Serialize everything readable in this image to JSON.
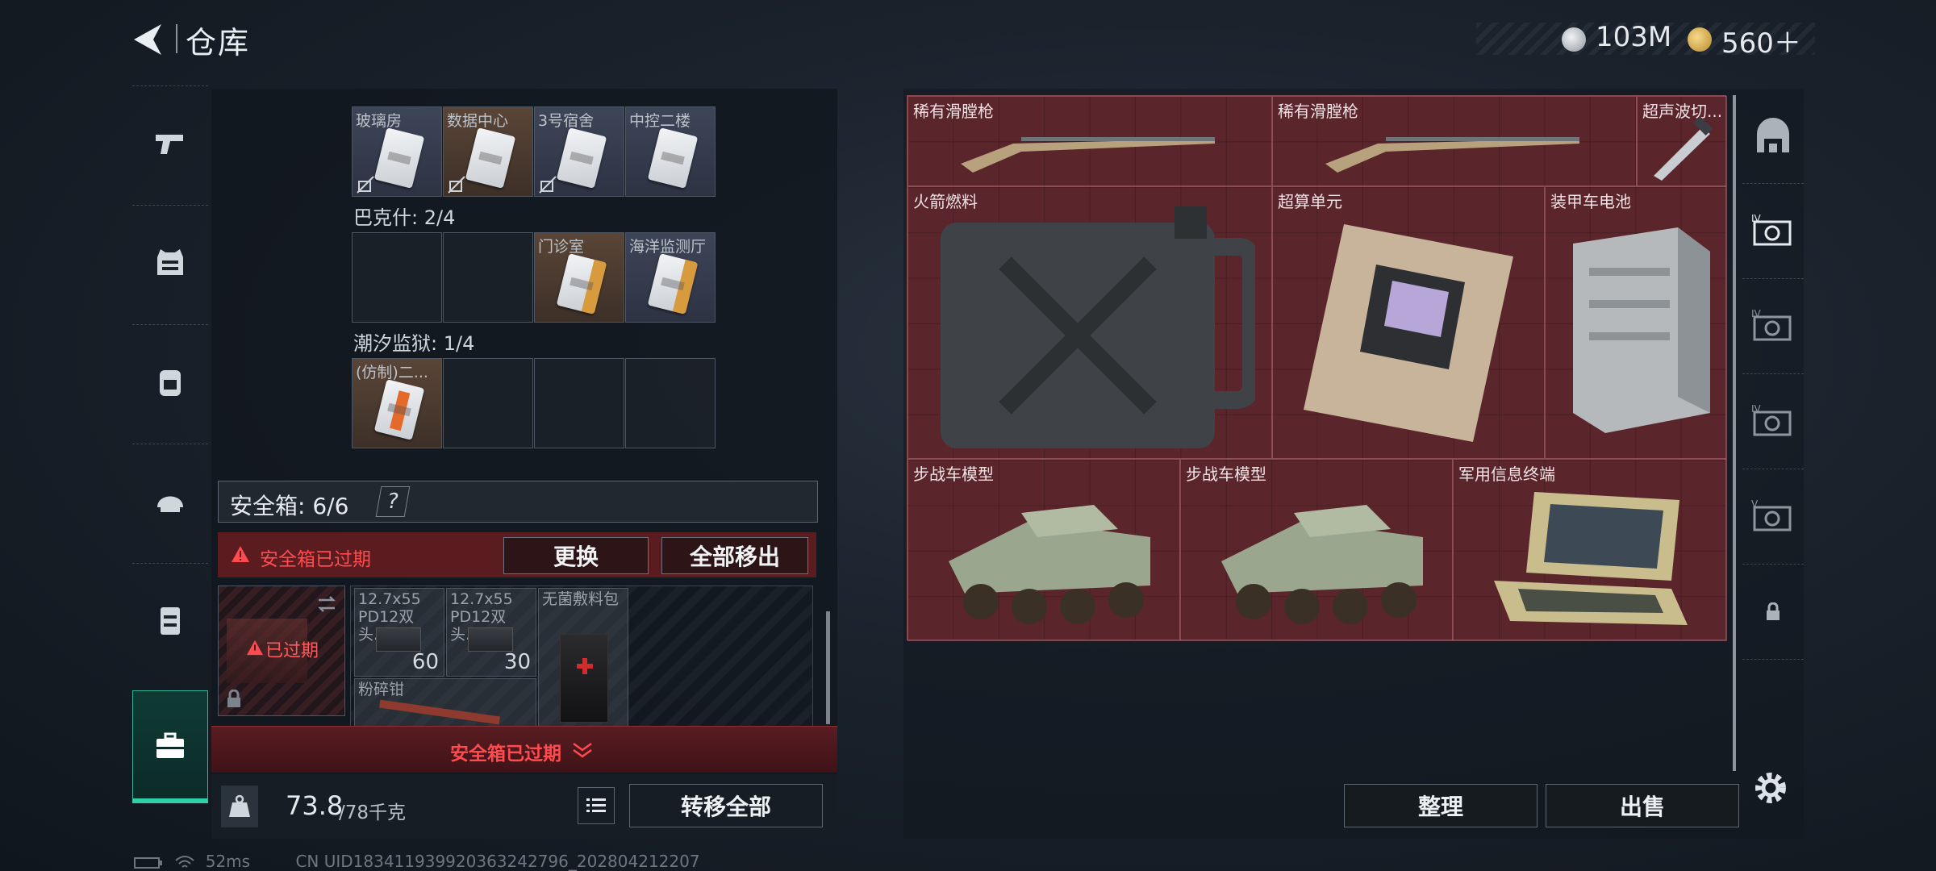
{
  "header": {
    "title": "仓库"
  },
  "currency": {
    "coins": "103M",
    "gold": "560＋"
  },
  "left_panel": {
    "keycard_group_1": [
      {
        "name": "玻璃房"
      },
      {
        "name": "数据中心"
      },
      {
        "name": "3号宿舍"
      },
      {
        "name": "中控二楼"
      }
    ],
    "group_2": {
      "label": "巴克什: 2/4",
      "items": [
        {
          "name": "门诊室"
        },
        {
          "name": "海洋监测厅"
        }
      ]
    },
    "group_3": {
      "label": "潮汐监狱: 1/4",
      "items": [
        {
          "name": "(仿制)二..."
        }
      ]
    },
    "safe_box": {
      "label": "安全箱: 6/6",
      "help": "?",
      "expired_text": "安全箱已过期",
      "replace_label": "更换",
      "remove_all_label": "全部移出",
      "box_status": "已过期",
      "items": [
        {
          "name": "12.7x55 PD12双头...",
          "count": "60"
        },
        {
          "name": "12.7x55 PD12双头...",
          "count": "30"
        },
        {
          "name": "无菌敷料包",
          "count": ""
        },
        {
          "name": "粉碎钳",
          "count": ""
        }
      ],
      "expired_banner": "安全箱已过期"
    },
    "weight": {
      "current": "73.8",
      "max": "/78千克"
    },
    "transfer_all_label": "转移全部"
  },
  "stash": {
    "items": [
      {
        "name": "稀有滑膛枪"
      },
      {
        "name": "稀有滑膛枪"
      },
      {
        "name": "超声波切..."
      },
      {
        "name": "火箭燃料"
      },
      {
        "name": "超算单元"
      },
      {
        "name": "装甲车电池"
      },
      {
        "name": "步战车模型"
      },
      {
        "name": "步战车模型"
      },
      {
        "name": "军用信息终端"
      }
    ],
    "sort_label": "整理",
    "sell_label": "出售"
  },
  "status_bar": {
    "ping": "52ms",
    "uid": "CN UID18341193992036324279​6_202804212207"
  },
  "colors": {
    "accent": "#2fd0a7",
    "danger": "#e0393f",
    "stash_bg": "#5a252b"
  }
}
